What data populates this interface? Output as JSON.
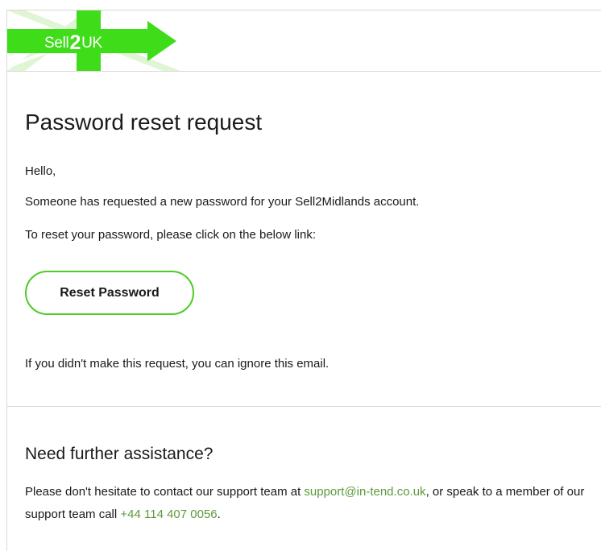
{
  "brand": {
    "logo_prefix": "Sell",
    "logo_number": "2",
    "logo_suffix": "UK",
    "accent_color": "#3fdc1a",
    "button_border_color": "#4ecb26",
    "link_color": "#5e9a3c"
  },
  "email": {
    "title": "Password reset request",
    "greeting": "Hello,",
    "line1": "Someone has requested a new password for your Sell2Midlands account.",
    "line2": "To reset your password, please click on the below link:",
    "button_label": "Reset Password",
    "ignore_note": "If you didn't make this request, you can ignore this email."
  },
  "assistance": {
    "title": "Need further assistance?",
    "text_before_email": "Please don't hesitate to contact our support team at ",
    "support_email": "support@in-tend.co.uk",
    "text_before_phone": ", or speak to a member of our support team call ",
    "support_phone": "+44 114 407 0056",
    "text_end": "."
  }
}
